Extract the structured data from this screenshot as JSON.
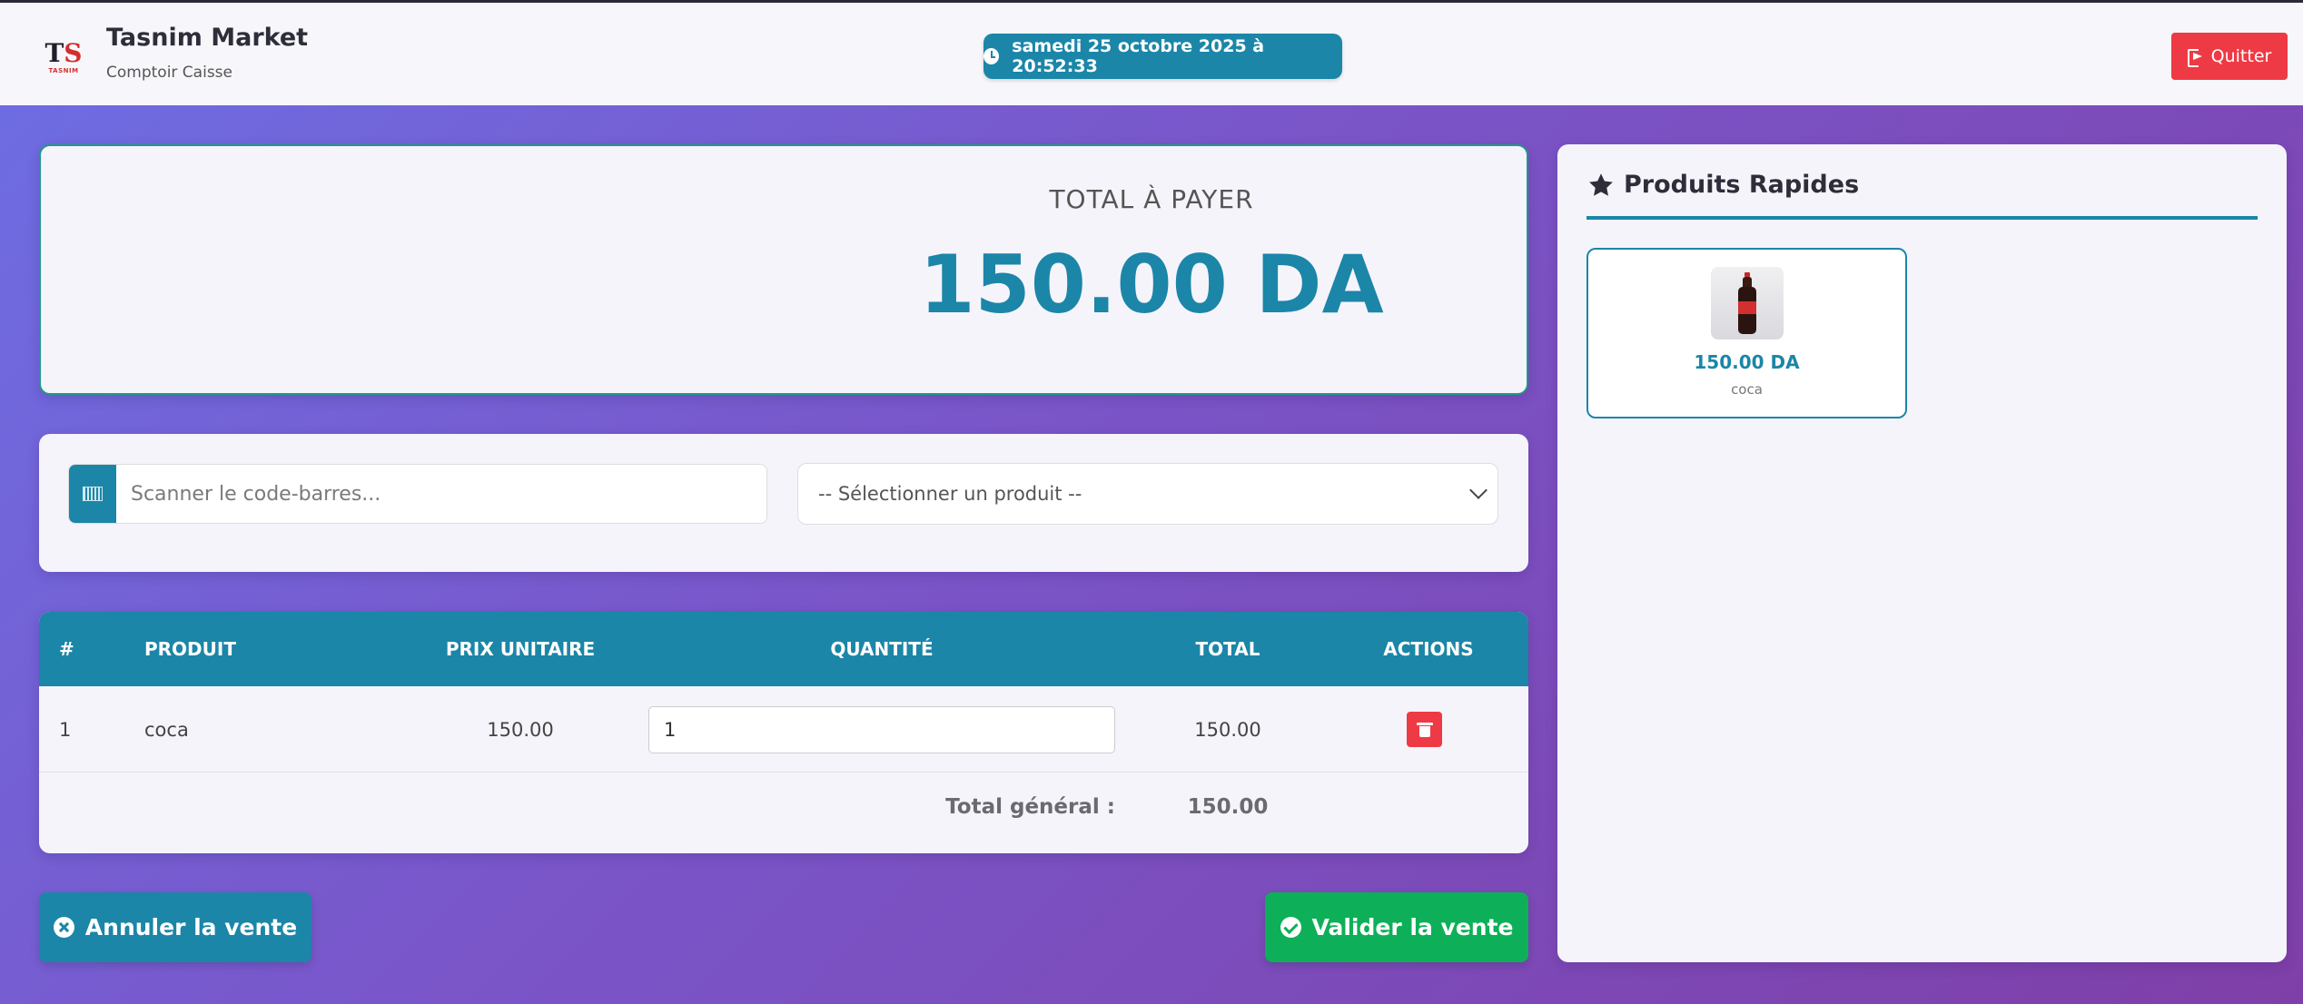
{
  "header": {
    "logo": {
      "text_t": "T",
      "text_s": "S",
      "subtitle": "TASNIM"
    },
    "title": "Tasnim Market",
    "subtitle": "Comptoir Caisse",
    "datetime": "samedi 25 octobre 2025 à 20:52:33",
    "quit_label": "Quitter"
  },
  "total": {
    "label": "TOTAL À PAYER",
    "amount": "150.00 DA"
  },
  "search": {
    "barcode_placeholder": "Scanner le code-barres...",
    "product_select_value": "-- Sélectionner un produit --"
  },
  "table": {
    "columns": [
      "#",
      "PRODUIT",
      "PRIX UNITAIRE",
      "QUANTITÉ",
      "TOTAL",
      "ACTIONS"
    ],
    "rows": [
      {
        "index": "1",
        "product": "coca",
        "unit_price": "150.00",
        "quantity": "1",
        "total": "150.00"
      }
    ],
    "grand_total_label": "Total général :",
    "grand_total_value": "150.00"
  },
  "actions": {
    "cancel_label": "Annuler la vente",
    "validate_label": "Valider la vente"
  },
  "quick_products": {
    "title": "Produits Rapides",
    "items": [
      {
        "price": "150.00 DA",
        "name": "coca"
      }
    ]
  },
  "colors": {
    "primary": "#1b86a8",
    "danger": "#ee3a45",
    "success": "#0db058"
  }
}
